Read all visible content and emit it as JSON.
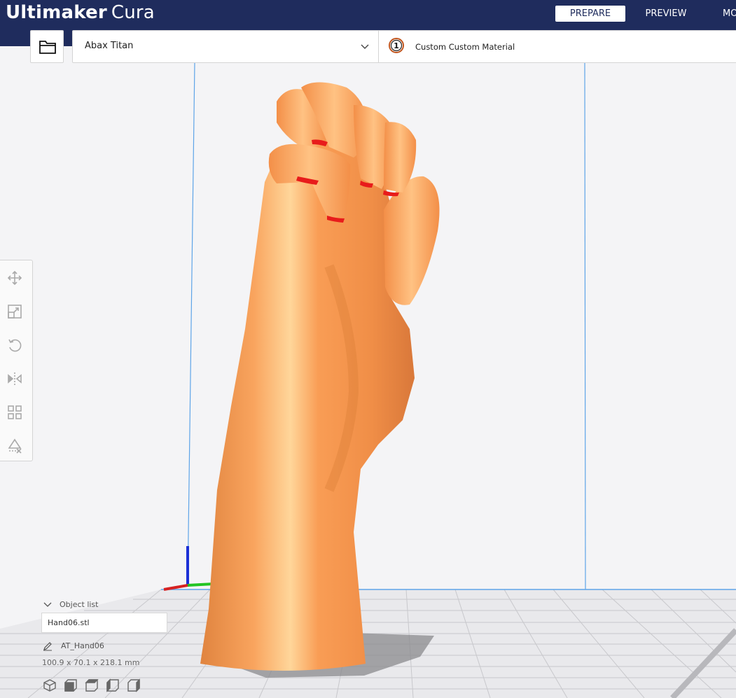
{
  "app": {
    "logo_bold": "Ultimaker",
    "logo_light": "Cura"
  },
  "stages": [
    {
      "label": "PREPARE",
      "active": true
    },
    {
      "label": "PREVIEW",
      "active": false
    },
    {
      "label": "MO",
      "active": false
    }
  ],
  "toolbar": {
    "open_file_icon": "folder-icon",
    "printer_name": "Abax Titan",
    "printer_dropdown_icon": "chevron-down-icon",
    "extruder_number": "1",
    "material_name": "Custom Custom Material"
  },
  "tools": [
    {
      "name": "move",
      "icon": "move-icon"
    },
    {
      "name": "scale",
      "icon": "scale-icon"
    },
    {
      "name": "rotate",
      "icon": "rotate-icon"
    },
    {
      "name": "mirror",
      "icon": "mirror-icon"
    },
    {
      "name": "per-model-settings",
      "icon": "per-model-settings-icon"
    },
    {
      "name": "support-blocker",
      "icon": "support-blocker-icon"
    }
  ],
  "object_list": {
    "header": "Object list",
    "items": [
      "Hand06.stl"
    ],
    "job_name": "AT_Hand06",
    "dimensions": "100.9 x 70.1 x 218.1 mm"
  },
  "view_buttons": [
    "3d-view-icon",
    "front-view-icon",
    "top-view-icon",
    "left-view-icon",
    "right-view-icon"
  ],
  "colors": {
    "header_bg": "#1f2c5d",
    "model": "#f7a05a",
    "overhang": "#e81b1b",
    "build_volume_line": "#5da4e8",
    "grid": "#c6c6c6"
  }
}
